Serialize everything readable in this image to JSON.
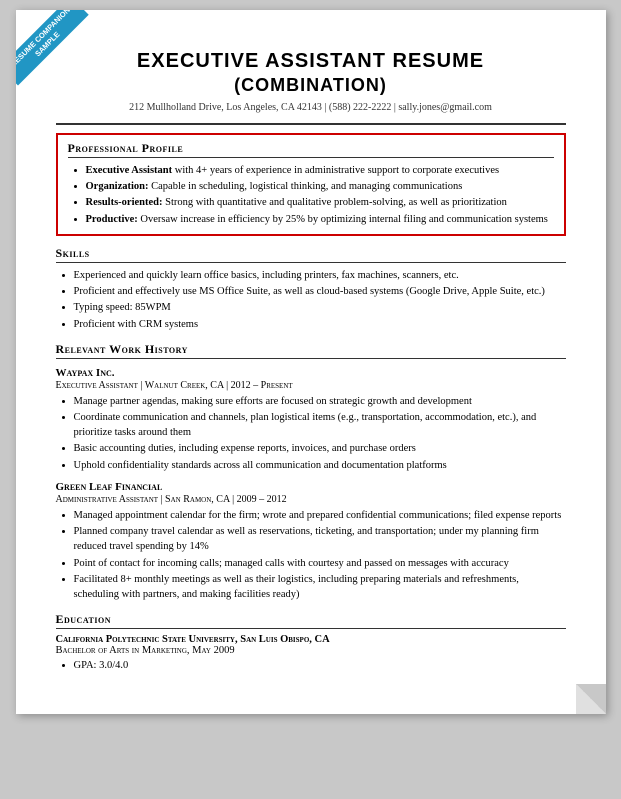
{
  "ribbon": {
    "line1": "RESUME COMPANION",
    "line2": "SAMPLE"
  },
  "header": {
    "title_line1": "EXECUTIVE ASSISTANT RESUME",
    "title_line2": "(COMBINATION)",
    "contact": "212 Mullholland Drive, Los Angeles, CA 42143  |  (588) 222-2222  |  sally.jones@gmail.com"
  },
  "sections": {
    "professional_profile": {
      "heading": "Professional Profile",
      "items": [
        {
          "term": "Executive Assistant",
          "rest": " with 4+ years of experience in administrative support to corporate executives"
        },
        {
          "term": "Organization:",
          "rest": " Capable in scheduling, logistical thinking, and managing communications"
        },
        {
          "term": "Results-oriented:",
          "rest": " Strong with quantitative and qualitative problem-solving, as well as prioritization"
        },
        {
          "term": "Productive:",
          "rest": " Oversaw increase in efficiency by 25% by optimizing internal filing and communication systems"
        }
      ]
    },
    "skills": {
      "heading": "Skills",
      "items": [
        "Experienced and quickly learn office basics, including printers, fax machines, scanners, etc.",
        "Proficient and effectively use MS Office Suite, as well as cloud-based systems (Google Drive, Apple Suite, etc.)",
        "Typing speed: 85WPM",
        "Proficient with CRM systems"
      ]
    },
    "work_history": {
      "heading": "Relevant Work History",
      "jobs": [
        {
          "company": "Waypax Inc.",
          "title_line": "Executive Assistant  |  Walnut Creek, CA  |  2012 – Present",
          "items": [
            "Manage partner agendas, making sure efforts are focused on strategic growth and development",
            "Coordinate communication and channels, plan logistical items (e.g., transportation, accommodation, etc.), and prioritize tasks around them",
            "Basic accounting duties, including expense reports, invoices, and purchase orders",
            "Uphold confidentiality standards across all communication and documentation platforms"
          ]
        },
        {
          "company": "Green Leaf Financial",
          "title_line": "Administrative Assistant  |  San Ramon, CA  |  2009 – 2012",
          "items": [
            "Managed appointment calendar for the firm; wrote and prepared confidential communications; filed expense reports",
            "Planned company travel calendar as well as reservations, ticketing, and transportation; under my planning firm reduced travel spending by 14%",
            "Point of contact for incoming calls; managed calls with courtesy and passed on messages with accuracy",
            "Facilitated 8+ monthly meetings as well as their logistics, including preparing materials and refreshments, scheduling with partners, and making facilities ready)"
          ]
        }
      ]
    },
    "education": {
      "heading": "Education",
      "school": "California Polytechnic State University, San Luis Obispo, CA",
      "degree": "Bachelor of Arts in Marketing, May 2009",
      "gpa": "GPA: 3.0/4.0"
    }
  }
}
